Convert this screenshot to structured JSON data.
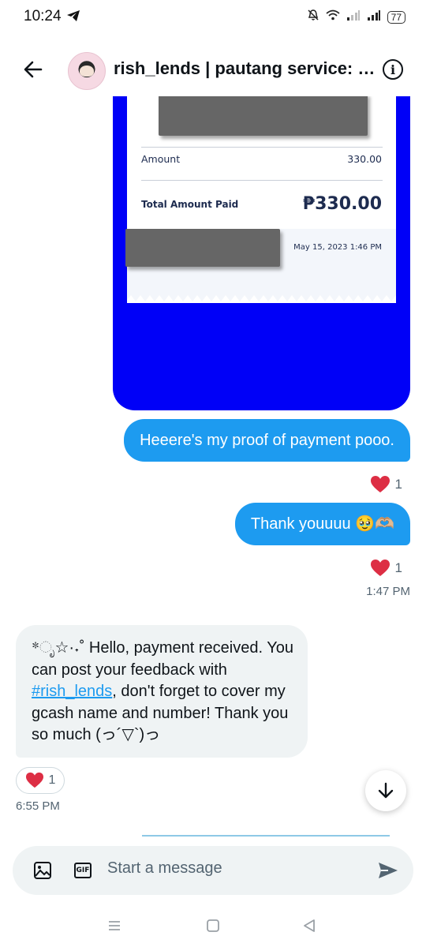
{
  "status_bar": {
    "time": "10:24",
    "battery": "77"
  },
  "header": {
    "title": "rish_lends | pautang service: o..."
  },
  "receipt": {
    "amount_label": "Amount",
    "amount_value": "330.00",
    "total_label": "Total Amount Paid",
    "total_value": "₱330.00",
    "date": "May 15, 2023 1:46 PM"
  },
  "messages": {
    "outgoing_1": "Heeere's my proof of payment pooo.",
    "outgoing_1_reaction": "1",
    "outgoing_2": "Thank youuuu 🥹🫶🏼",
    "outgoing_2_reaction": "1",
    "outgoing_time": "1:47 PM",
    "incoming_prefix": "*ೃ☆·˖˚ Hello, payment received. You can post your feedback with ",
    "incoming_hashtag": "#rish_lends",
    "incoming_suffix": ", don't forget to cover my gcash name and number! Thank you so much (っ´▽`)っ",
    "incoming_reaction": "1",
    "incoming_time": "6:55 PM"
  },
  "composer": {
    "placeholder": "Start a message",
    "gif_label": "GIF"
  },
  "colors": {
    "accent": "#1d9bf0",
    "receipt_bg": "#0000f7",
    "heart": "#e0245e",
    "incoming_bubble": "#eff3f4"
  }
}
